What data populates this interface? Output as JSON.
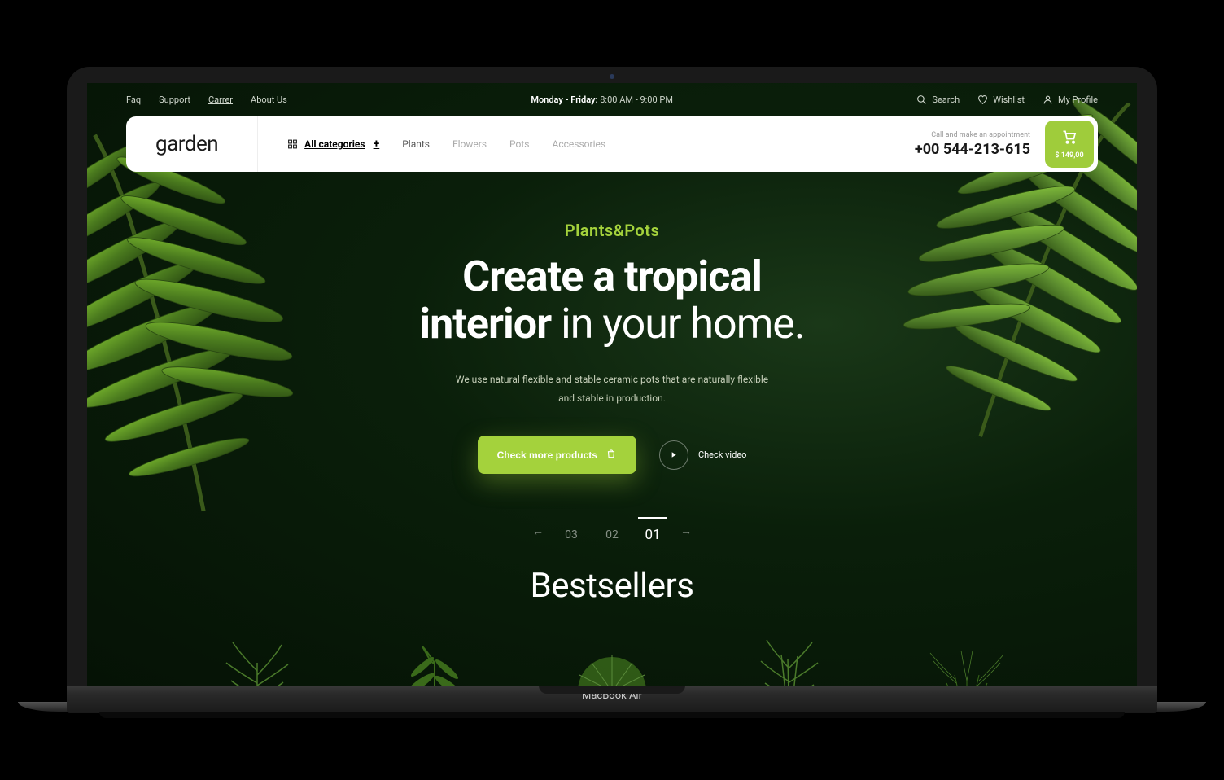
{
  "topbar": {
    "links": [
      "Faq",
      "Support",
      "Carrer",
      "About Us"
    ],
    "hours_label": "Monday - Friday:",
    "hours_value": "8:00 AM - 9:00 PM",
    "search": "Search",
    "wishlist": "Wishlist",
    "profile": "My Profile"
  },
  "nav": {
    "logo": "garden",
    "all_categories": "All categories",
    "links": [
      "Plants",
      "Flowers",
      "Pots",
      "Accessories"
    ],
    "contact_label": "Call and make an appointment",
    "phone": "+00 544-213-615",
    "cart_total": "$ 149,00"
  },
  "hero": {
    "eyebrow": "Plants&Pots",
    "h1_bold1": "Create a tropical",
    "h1_bold2": "interior",
    "h1_rest": " in your home.",
    "sub1": "We use natural flexible and stable ceramic pots that are naturally flexible",
    "sub2": "and stable in production.",
    "cta": "Check more products",
    "video": "Check video"
  },
  "pagination": {
    "items": [
      "03",
      "02",
      "01"
    ],
    "active": "01"
  },
  "section": {
    "bestsellers": "Bestsellers"
  },
  "device": {
    "label": "MacBook Air"
  }
}
